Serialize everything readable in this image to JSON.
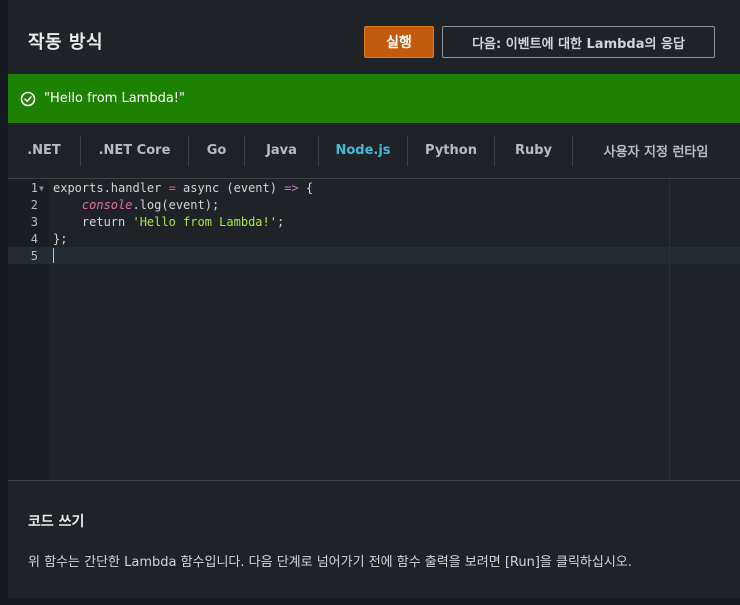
{
  "header": {
    "title": "작동 방식",
    "run_label": "실행",
    "next_label": "다음: 이벤트에 대한 Lambda의 응답"
  },
  "result": {
    "message": "\"Hello from Lambda!\"",
    "icon": "check-circle-icon"
  },
  "tabs": [
    {
      "label": ".NET",
      "active": false
    },
    {
      "label": ".NET Core",
      "active": false
    },
    {
      "label": "Go",
      "active": false
    },
    {
      "label": "Java",
      "active": false
    },
    {
      "label": "Node.js",
      "active": true
    },
    {
      "label": "Python",
      "active": false
    },
    {
      "label": "Ruby",
      "active": false
    },
    {
      "label": "사용자 지정 런타임",
      "active": false
    }
  ],
  "editor": {
    "line_numbers": [
      "1",
      "2",
      "3",
      "4",
      "5"
    ],
    "lines": [
      {
        "segments": [
          [
            "exports.handler ",
            "kw"
          ],
          [
            "= ",
            "op"
          ],
          [
            "async ",
            "kw"
          ],
          [
            "(event) ",
            "kw"
          ],
          [
            "=>",
            "arrow"
          ],
          [
            " {",
            "kw"
          ]
        ]
      },
      {
        "segments": [
          [
            "    ",
            "kw"
          ],
          [
            "console",
            "italic-fn"
          ],
          [
            ".log(event);",
            "kw"
          ]
        ]
      },
      {
        "segments": [
          [
            "    return ",
            "kw"
          ],
          [
            "'Hello from Lambda!'",
            "str"
          ],
          [
            ";",
            "kw"
          ]
        ]
      },
      {
        "segments": [
          [
            "};",
            "kw"
          ]
        ]
      },
      {
        "segments": []
      }
    ]
  },
  "footer": {
    "title": "코드 쓰기",
    "description": "위 함수는 간단한 Lambda 함수입니다. 다음 단계로 넘어가기 전에 함수 출력을 보려면 [Run]을 클릭하십시오."
  },
  "colors": {
    "accent_orange": "#c45a0c",
    "success_green": "#1d8102",
    "active_tab": "#44b9d6"
  }
}
